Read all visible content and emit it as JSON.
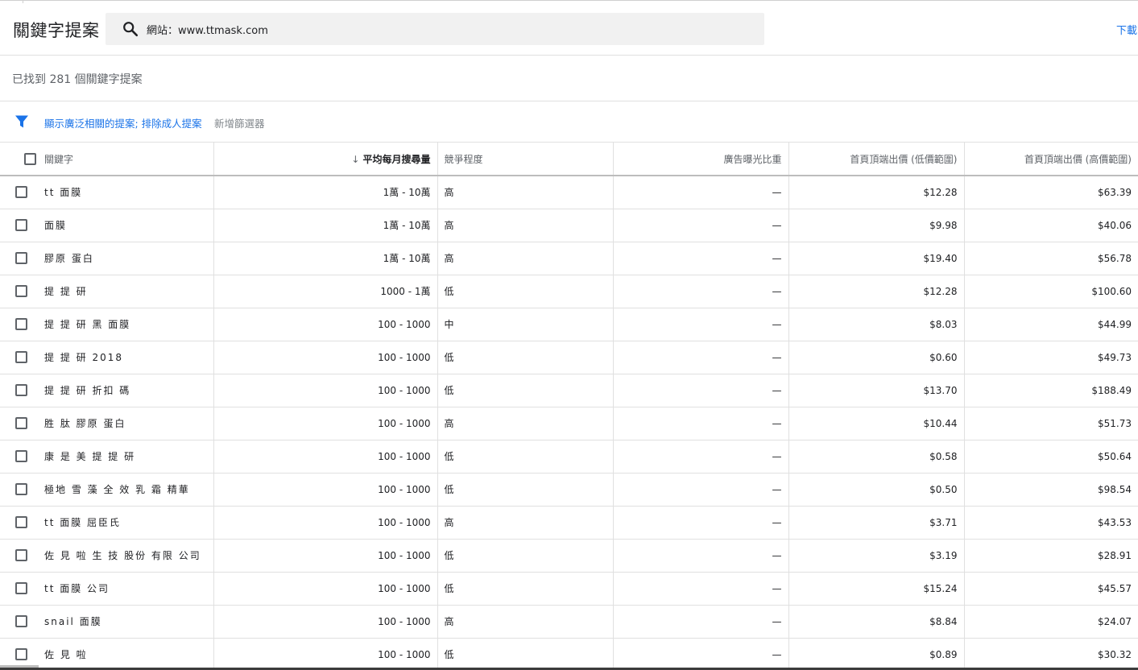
{
  "header": {
    "title": "關鍵字提案",
    "search_text": "網站：www.ttmask.com",
    "download_label": "下載"
  },
  "summary": {
    "found_text": "已找到 281 個關鍵字提案"
  },
  "filters": {
    "active_text": "顯示廣泛相關的提案; 排除成人提案",
    "add_label": "新增篩選器"
  },
  "table": {
    "columns": {
      "keyword": "關鍵字",
      "volume": "平均每月搜尋量",
      "competition": "競爭程度",
      "impression_share": "廣告曝光比重",
      "bid_low": "首頁頂端出價 (低價範圍)",
      "bid_high": "首頁頂端出價 (高價範圍)"
    },
    "rows": [
      {
        "keyword": "tt 面膜",
        "volume": "1萬 - 10萬",
        "competition": "高",
        "share": "—",
        "low": "$12.28",
        "high": "$63.39"
      },
      {
        "keyword": "面膜",
        "volume": "1萬 - 10萬",
        "competition": "高",
        "share": "—",
        "low": "$9.98",
        "high": "$40.06"
      },
      {
        "keyword": "膠原 蛋白",
        "volume": "1萬 - 10萬",
        "competition": "高",
        "share": "—",
        "low": "$19.40",
        "high": "$56.78"
      },
      {
        "keyword": "提 提 研",
        "volume": "1000 - 1萬",
        "competition": "低",
        "share": "—",
        "low": "$12.28",
        "high": "$100.60"
      },
      {
        "keyword": "提 提 研 黑 面膜",
        "volume": "100 - 1000",
        "competition": "中",
        "share": "—",
        "low": "$8.03",
        "high": "$44.99"
      },
      {
        "keyword": "提 提 研 2018",
        "volume": "100 - 1000",
        "competition": "低",
        "share": "—",
        "low": "$0.60",
        "high": "$49.73"
      },
      {
        "keyword": "提 提 研 折扣 碼",
        "volume": "100 - 1000",
        "competition": "低",
        "share": "—",
        "low": "$13.70",
        "high": "$188.49"
      },
      {
        "keyword": "胜 肽 膠原 蛋白",
        "volume": "100 - 1000",
        "competition": "高",
        "share": "—",
        "low": "$10.44",
        "high": "$51.73"
      },
      {
        "keyword": "康 是 美 提 提 研",
        "volume": "100 - 1000",
        "competition": "低",
        "share": "—",
        "low": "$0.58",
        "high": "$50.64"
      },
      {
        "keyword": "極地 雪 藻 全 效 乳 霜 精華",
        "volume": "100 - 1000",
        "competition": "低",
        "share": "—",
        "low": "$0.50",
        "high": "$98.54"
      },
      {
        "keyword": "tt 面膜 屈臣氏",
        "volume": "100 - 1000",
        "competition": "高",
        "share": "—",
        "low": "$3.71",
        "high": "$43.53"
      },
      {
        "keyword": "佐 見 啦 生 技 股份 有限 公司",
        "volume": "100 - 1000",
        "competition": "低",
        "share": "—",
        "low": "$3.19",
        "high": "$28.91"
      },
      {
        "keyword": "tt 面膜 公司",
        "volume": "100 - 1000",
        "competition": "低",
        "share": "—",
        "low": "$15.24",
        "high": "$45.57"
      },
      {
        "keyword": "snail 面膜",
        "volume": "100 - 1000",
        "competition": "高",
        "share": "—",
        "low": "$8.84",
        "high": "$24.07"
      },
      {
        "keyword": "佐 見 啦",
        "volume": "100 - 1000",
        "competition": "低",
        "share": "—",
        "low": "$0.89",
        "high": "$30.32"
      }
    ]
  },
  "colors": {
    "accent": "#1a73e8",
    "search_bg": "#f1f1f1",
    "divider": "#e0e0e0"
  }
}
